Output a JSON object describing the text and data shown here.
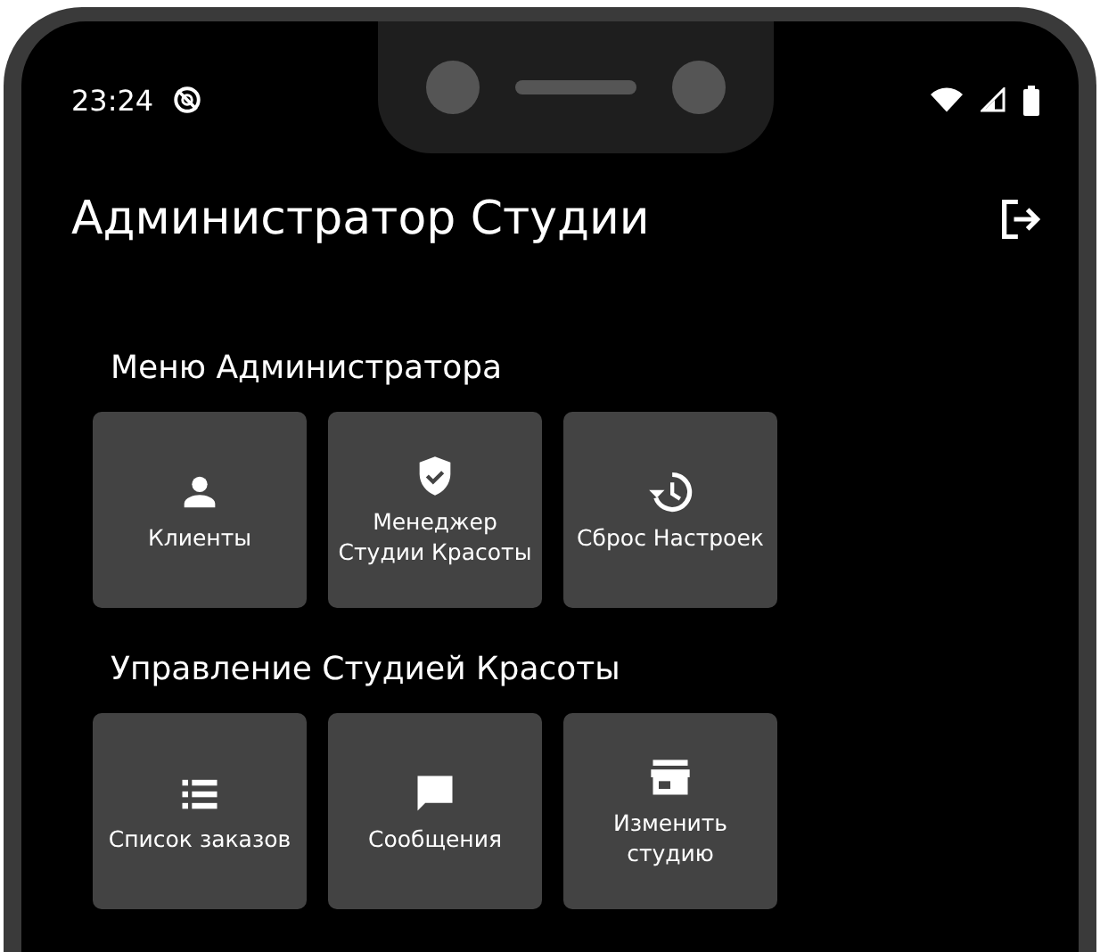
{
  "status_bar": {
    "time": "23:24"
  },
  "app_bar": {
    "title": "Администратор Студии"
  },
  "sections": [
    {
      "title": "Меню Администратора",
      "tiles": [
        {
          "label": "Клиенты"
        },
        {
          "label": "Менеджер Студии Красоты"
        },
        {
          "label": "Сброс Настроек"
        }
      ]
    },
    {
      "title": "Управление Студией Красоты",
      "tiles": [
        {
          "label": "Список заказов"
        },
        {
          "label": "Сообщения"
        },
        {
          "label": "Изменить студию"
        }
      ]
    }
  ]
}
